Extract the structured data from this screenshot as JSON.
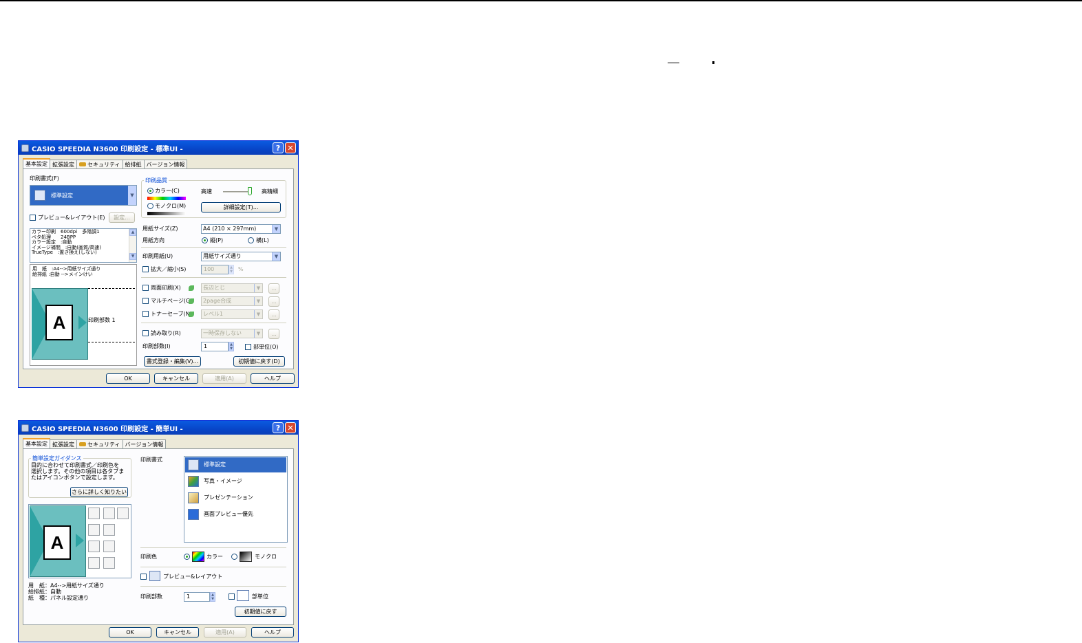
{
  "dialog1": {
    "title": "CASIO SPEEDIA N3600 印刷設定 - 標準UI -",
    "tabs": [
      "基本設定",
      "拡張設定",
      "セキュリティ",
      "給排紙",
      "バージョン情報"
    ],
    "print_format_label": "印刷書式(F)",
    "print_format_value": "標準設定",
    "preview_checkbox": "プレビュー&レイアウト(E)",
    "preview_settings_button": "設定...",
    "info_lines": [
      "カラー印刷　600dpi　多階調1",
      "ベタ処理　　24BPP",
      "カラー設定　:自動",
      "イメージ補間　:自動(画質/高速)",
      "TrueType　:置き換え(しない)"
    ],
    "paper_lines": [
      "用　紙　:A4-->用紙サイズ通り",
      "給排紙 :自動 -->メインけい"
    ],
    "preview_letter": "A",
    "copies_preview_label": "印刷部数 1",
    "quality_group": "印刷品質",
    "color_radio": "カラー(C)",
    "mono_radio": "モノクロ(M)",
    "speed_label": "高速",
    "fine_label": "高精細",
    "detail_button": "詳細設定(T)...",
    "paper_size_label": "用紙サイズ(Z)",
    "paper_size_value": "A4 (210 × 297mm)",
    "orientation_label": "用紙方向",
    "portrait_radio": "縦(P)",
    "landscape_radio": "横(L)",
    "print_paper_label": "印刷用紙(U)",
    "print_paper_value": "用紙サイズ通り",
    "scale_checkbox": "拡大／縮小(S)",
    "scale_value": "100",
    "scale_unit": "%",
    "duplex_checkbox": "両面印刷(X)",
    "duplex_value": "長辺とじ",
    "multipage_checkbox": "マルチページ(G)",
    "multipage_value": "2page合成",
    "toner_checkbox": "トナーセーブ(N)",
    "toner_value": "レベル1",
    "readout_checkbox": "読み取り(R)",
    "readout_value": "一時保存しない",
    "more_button": "...",
    "copies_label": "印刷部数(I)",
    "copies_value": "1",
    "collate_checkbox": "部単位(O)",
    "register_button": "書式登録・編集(V)...",
    "reset_button": "初期値に戻す(D)",
    "ok_button": "OK",
    "cancel_button": "キャンセル",
    "apply_button": "適用(A)",
    "help_button": "ヘルプ"
  },
  "dialog2": {
    "title": "CASIO SPEEDIA N3600 印刷設定 - 簡単UI -",
    "tabs": [
      "基本設定",
      "拡張設定",
      "セキュリティ",
      "バージョン情報"
    ],
    "guidance_group": "簡単設定ガイダンス",
    "guidance_text": [
      "目的に合わせて印刷書式／印刷色を",
      "選択します。その他の項目は各タブま",
      "たはアイコンボタンで設定します。"
    ],
    "more_info_button": "さらに詳しく知りたい",
    "preview_letter": "A",
    "paper_lines": [
      "用　紙：A4-->用紙サイズ通り",
      "給排紙：自動",
      "紙　種：パネル設定通り"
    ],
    "print_format_label": "印刷書式",
    "formats": [
      "標準設定",
      "写真・イメージ",
      "プレゼンテーション",
      "画面プレビュー優先"
    ],
    "print_color_label": "印刷色",
    "color_option": "カラー",
    "mono_option": "モノクロ",
    "preview_checkbox": "プレビュー&レイアウト",
    "copies_label": "印刷部数",
    "copies_value": "1",
    "collate_label": "部単位",
    "reset_button": "初期値に戻す",
    "ok_button": "OK",
    "cancel_button": "キャンセル",
    "apply_button": "適用(A)",
    "help_button": "ヘルプ"
  }
}
